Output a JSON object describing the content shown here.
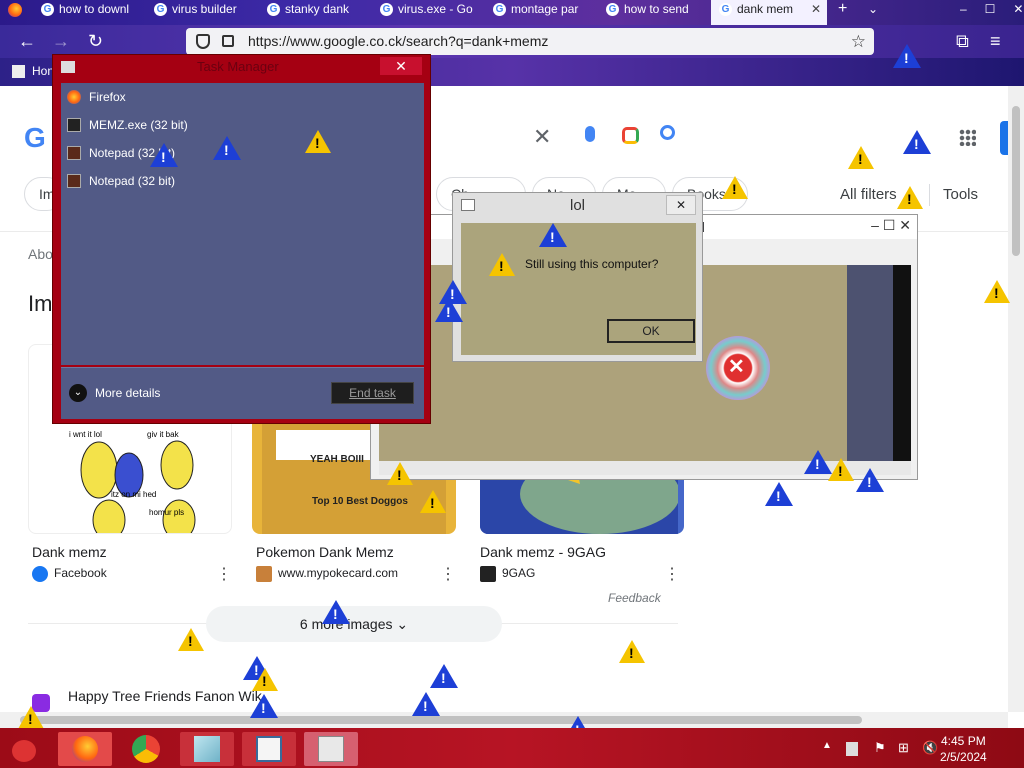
{
  "browser": {
    "tabs": [
      {
        "label": "how to downl"
      },
      {
        "label": "virus builder"
      },
      {
        "label": "stanky dank"
      },
      {
        "label": "virus.exe - Go"
      },
      {
        "label": "montage par"
      },
      {
        "label": "how to send"
      },
      {
        "label": "dank mem"
      }
    ],
    "new_tab_symbol": "+",
    "url": "https://www.google.co.ck/search?q=dank+memz",
    "bookmark_label": "Hon"
  },
  "google": {
    "logo": "G",
    "filters_label": "All filters",
    "tools_label": "Tools",
    "chips": [
      "Im",
      "Ch",
      "Ne",
      "Mo",
      "Books"
    ],
    "about_text": "Abo",
    "images_heading": "Im",
    "cards": [
      {
        "title": "Dank memz",
        "source": "Facebook",
        "fav_color": "#1877f2"
      },
      {
        "title": "Pokemon Dank Memz",
        "source": "www.mypokecard.com",
        "fav_color": "#c8803a"
      },
      {
        "title": "Dank memz - 9GAG",
        "source": "9GAG",
        "fav_color": "#222222"
      }
    ],
    "meme_text": [
      "i wnt it lol",
      "giv it bak",
      "itz on mi hed",
      "homur pls"
    ],
    "poke_text": [
      "YEAH BOIII",
      "Top 10 Best Doggos"
    ],
    "feedback": "Feedback",
    "more_images": "6 more images",
    "next_result": "Happy Tree Friends Fanon Wik"
  },
  "task_manager": {
    "title": "Task Manager",
    "close_symbol": "✕",
    "processes": [
      {
        "name": "Firefox",
        "icon": "firefox-icon"
      },
      {
        "name": "MEMZ.exe (32 bit)",
        "icon": "app-icon"
      },
      {
        "name": "Notepad (32 bit)",
        "icon": "notepad-icon"
      },
      {
        "name": "Notepad (32 bit)",
        "icon": "notepad-icon"
      }
    ],
    "more_details": "More details",
    "end_task": "End task"
  },
  "notepad_window": {
    "title_fragment": "d",
    "controls": "–  ☐  ✕"
  },
  "lol_dialog": {
    "title": "lol",
    "message": "Still using this computer?",
    "ok_label": "OK",
    "close_symbol": "✕"
  },
  "taskbar": {
    "time": "4:45 PM",
    "date": "2/5/2024",
    "apps": [
      "firefox",
      "chrome",
      "notepad",
      "memz",
      "task-manager"
    ]
  },
  "colors": {
    "taskbar": "#b71424",
    "taskmgr_frame": "#a50012",
    "dialog_body": "#aba47c",
    "warning_yellow": "#f5c400",
    "warning_blue": "#1d3fd6"
  }
}
